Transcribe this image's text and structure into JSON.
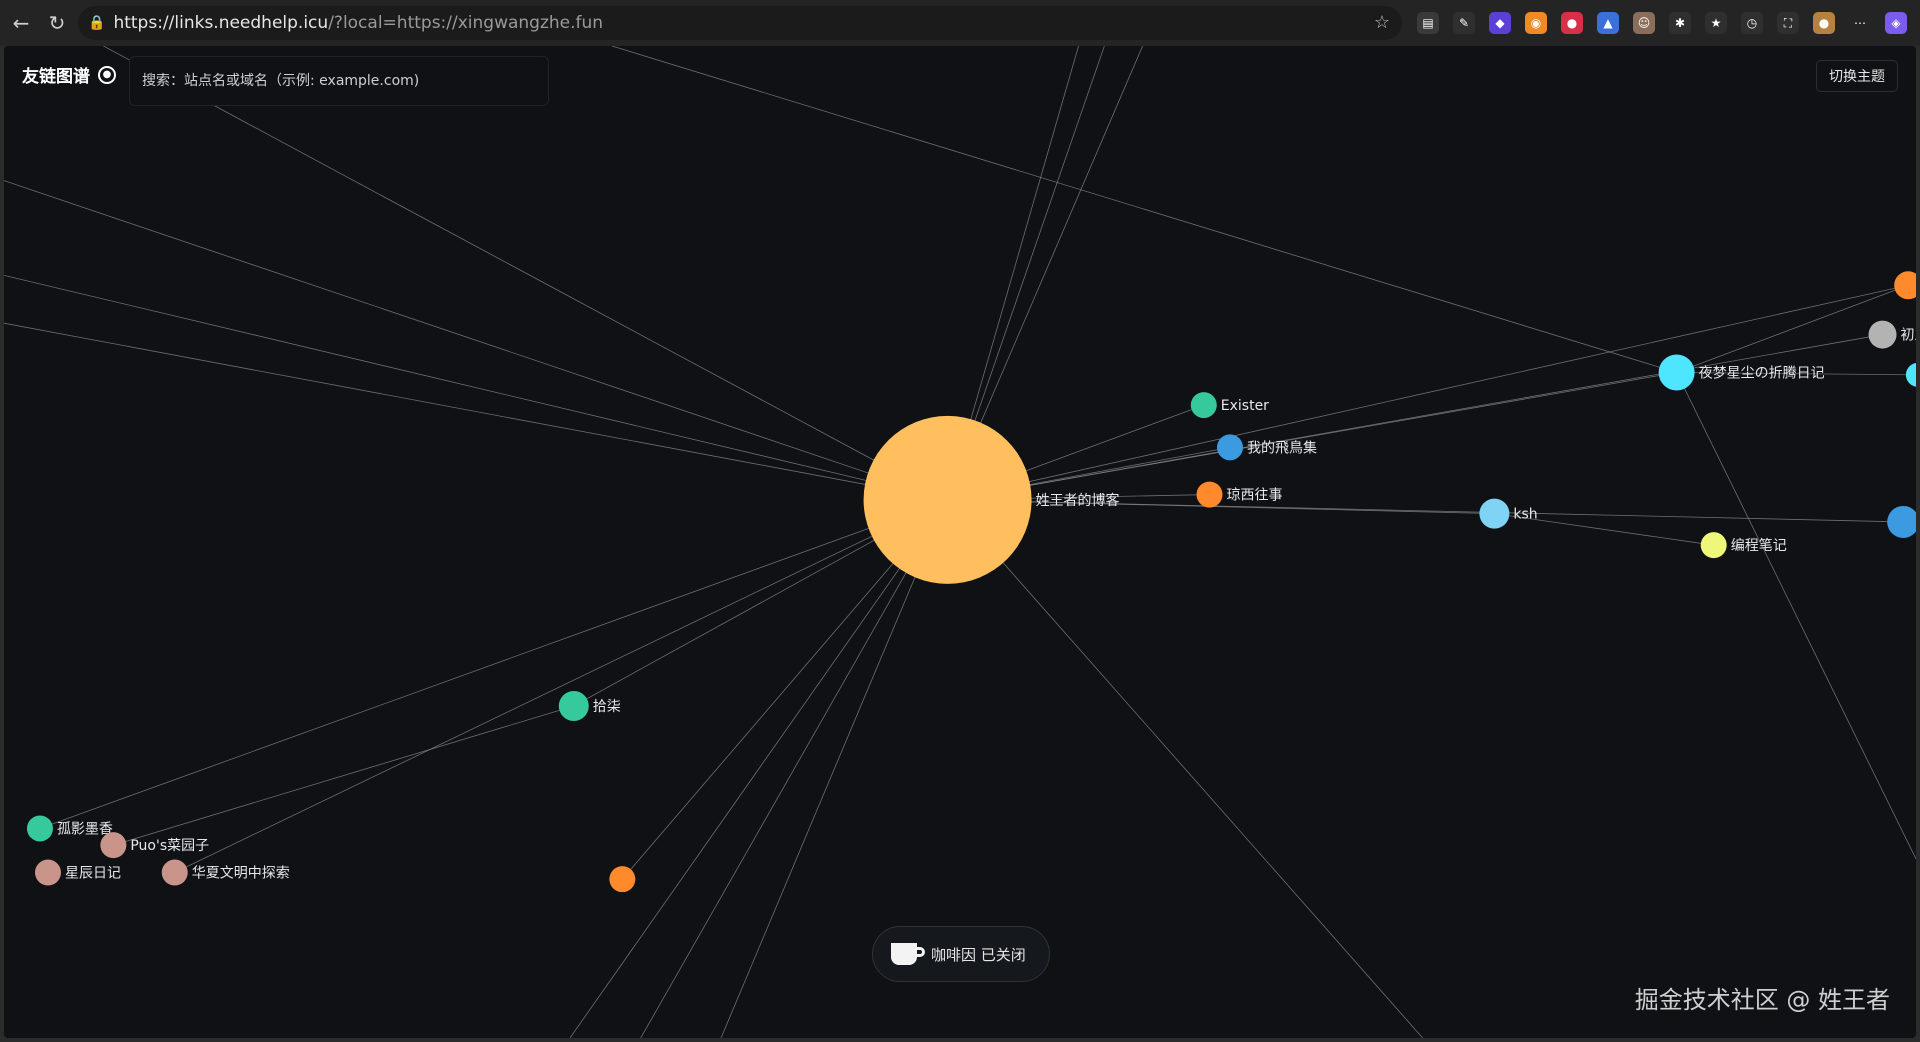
{
  "browser": {
    "url_host": "https://links.needhelp.icu",
    "url_path": "/?local=https://xingwangzhe.fun",
    "back": "←",
    "reload": "↻",
    "lock": "🔒",
    "star": "☆",
    "extensions": [
      {
        "icon": "reader-icon",
        "color": "#3a3a3a",
        "glyph": "▤"
      },
      {
        "icon": "bird-icon",
        "color": "#2f2f2f",
        "glyph": "✎"
      },
      {
        "icon": "ext-purple-icon",
        "color": "#5b3fd6",
        "glyph": "◆"
      },
      {
        "icon": "rss-icon",
        "color": "#f08a24",
        "glyph": "◉"
      },
      {
        "icon": "ext-red-icon",
        "color": "#d9304a",
        "glyph": "●"
      },
      {
        "icon": "ext-blue-icon",
        "color": "#3b6fd9",
        "glyph": "▲"
      },
      {
        "icon": "ext-face-icon",
        "color": "#8a6e5a",
        "glyph": "☺"
      },
      {
        "icon": "puzzle-icon",
        "color": "#2f2f2f",
        "glyph": "✱"
      },
      {
        "icon": "favorites-icon",
        "color": "#2f2f2f",
        "glyph": "★"
      },
      {
        "icon": "history-icon",
        "color": "#2f2f2f",
        "glyph": "◷"
      },
      {
        "icon": "screenshot-icon",
        "color": "#2f2f2f",
        "glyph": "⛶"
      },
      {
        "icon": "avatar-icon",
        "color": "#b5833f",
        "glyph": "●"
      },
      {
        "icon": "more-icon",
        "color": "#242424",
        "glyph": "⋯"
      },
      {
        "icon": "copilot-icon",
        "color": "#7a5cf0",
        "glyph": "◈"
      }
    ]
  },
  "header": {
    "brand": "友链图谱",
    "search_placeholder": "搜索：站点名或域名（示例: example.com)",
    "theme_button": "切换主题"
  },
  "coffee": {
    "label": "咖啡因 已关闭"
  },
  "watermark": "掘金技术社区 @ 姓王者",
  "graph": {
    "nodes": [
      {
        "id": "center",
        "label": "姓王者的博客",
        "color": "#ffbf5e",
        "r": 84,
        "lx": 0.4935,
        "ly": 0.4575
      },
      {
        "id": "exister",
        "label": "Exister",
        "color": "#35c99b",
        "r": 13,
        "lx": 0.6275,
        "ly": 0.362
      },
      {
        "id": "feiniao",
        "label": "我的飛鳥集",
        "color": "#3c9be0",
        "r": 13,
        "lx": 0.6412,
        "ly": 0.4046
      },
      {
        "id": "qiongxi",
        "label": "琼西往事",
        "color": "#ff8a2c",
        "r": 13,
        "lx": 0.6305,
        "ly": 0.4522
      },
      {
        "id": "ksh",
        "label": "ksh",
        "color": "#7fd4f5",
        "r": 15,
        "lx": 0.7795,
        "ly": 0.4714
      },
      {
        "id": "biancheng",
        "label": "编程笔记",
        "color": "#eef77a",
        "r": 13,
        "lx": 0.8942,
        "ly": 0.5032
      },
      {
        "id": "yemeng",
        "label": "夜梦星尘の折腾日记",
        "color": "#4ee6ff",
        "r": 18,
        "lx": 0.8748,
        "ly": 0.3291
      },
      {
        "id": "chuzhi",
        "label": "初之",
        "color": "#b3b3b3",
        "r": 14,
        "lx": 0.9825,
        "ly": 0.2909
      },
      {
        "id": "orange_edge",
        "label": "",
        "color": "#ff8a2c",
        "r": 14,
        "lx": 0.9959,
        "ly": 0.2412
      },
      {
        "id": "cyan_edge",
        "label": "",
        "color": "#4ee6ff",
        "r": 12,
        "lx": 1.001,
        "ly": 0.3315
      },
      {
        "id": "blue_edge",
        "label": "",
        "color": "#3c9be0",
        "r": 16,
        "lx": 0.9933,
        "ly": 0.4798
      },
      {
        "id": "shiqi",
        "label": "拾柒",
        "color": "#35c99b",
        "r": 15,
        "lx": 0.298,
        "ly": 0.6653
      },
      {
        "id": "guying",
        "label": "孤影墨香",
        "color": "#35c99b",
        "r": 13,
        "lx": 0.0188,
        "ly": 0.7888
      },
      {
        "id": "puo",
        "label": "Puo's菜园子",
        "color": "#c9948a",
        "r": 13,
        "lx": 0.0572,
        "ly": 0.8056
      },
      {
        "id": "xingchen",
        "label": "星辰日记",
        "color": "#c9948a",
        "r": 13,
        "lx": 0.023,
        "ly": 0.8332
      },
      {
        "id": "huaxia",
        "label": "华夏文明中探索",
        "color": "#c9948a",
        "r": 13,
        "lx": 0.0893,
        "ly": 0.8332
      },
      {
        "id": "orange_bottom",
        "label": "",
        "color": "#ff8a2c",
        "r": 13,
        "lx": 0.3234,
        "ly": 0.8399
      }
    ],
    "edges": [
      [
        "center",
        "exister"
      ],
      [
        "center",
        "feiniao"
      ],
      [
        "center",
        "qiongxi"
      ],
      [
        "center",
        "ksh"
      ],
      [
        "ksh",
        "biancheng"
      ],
      [
        "center",
        "yemeng"
      ],
      [
        "center",
        "chuzhi"
      ],
      [
        "center",
        "orange_edge"
      ],
      [
        "yemeng",
        "orange_edge"
      ],
      [
        "yemeng",
        "cyan_edge"
      ],
      [
        "center",
        "blue_edge"
      ],
      [
        "center",
        "shiqi"
      ],
      [
        "shiqi",
        "puo"
      ],
      [
        "center",
        "guying"
      ],
      [
        "center",
        "huaxia"
      ],
      [
        "center",
        "orange_bottom"
      ]
    ],
    "rays": [
      {
        "from": "center",
        "to": [
          0.0,
          0.1357
        ]
      },
      {
        "from": "center",
        "to": [
          0.0,
          0.2312
        ]
      },
      {
        "from": "center",
        "to": [
          0.0,
          0.2794
        ]
      },
      {
        "from": "center",
        "to": [
          0.052,
          0.0
        ]
      },
      {
        "from": "center",
        "to": [
          0.5755,
          0.0
        ]
      },
      {
        "from": "center",
        "to": [
          0.5955,
          0.0
        ]
      },
      {
        "from": "center",
        "to": [
          0.296,
          1.0
        ]
      },
      {
        "from": "center",
        "to": [
          0.333,
          1.0
        ]
      },
      {
        "from": "center",
        "to": [
          0.375,
          1.0
        ]
      },
      {
        "from": "center",
        "to": [
          0.742,
          1.0
        ]
      },
      {
        "from": "yemeng",
        "to": [
          1.0,
          0.8195
        ]
      },
      {
        "from": "yemeng",
        "to": [
          0.318,
          0.0
        ]
      },
      {
        "from": "center",
        "to": [
          0.562,
          0.0
        ]
      }
    ]
  }
}
